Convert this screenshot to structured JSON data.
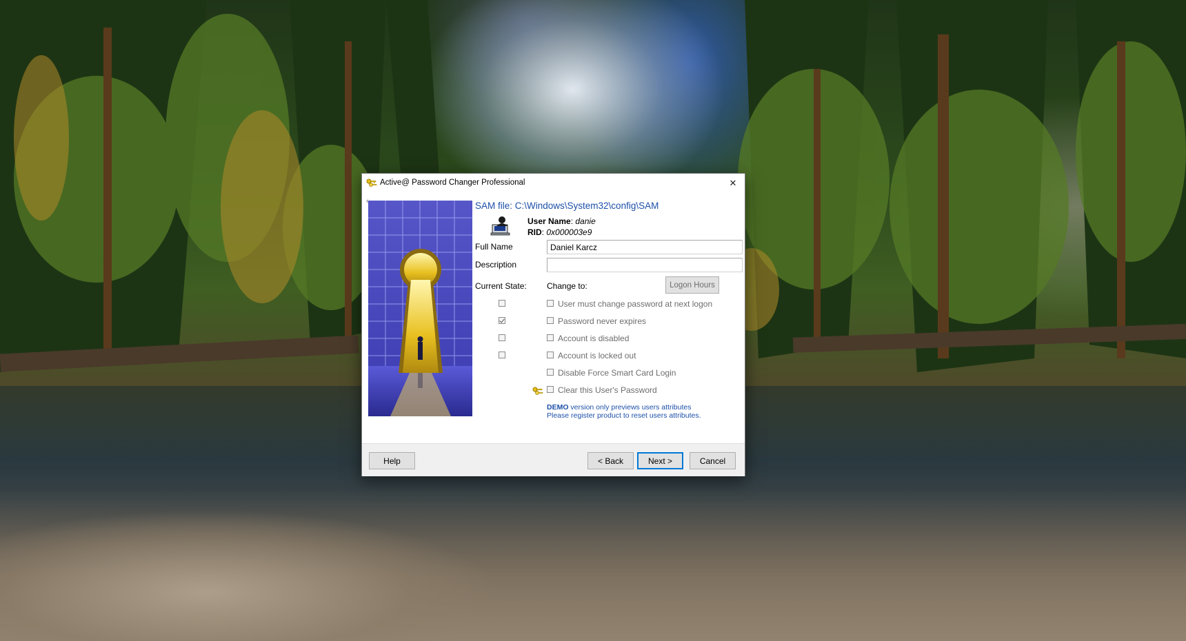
{
  "window": {
    "title": "Active@ Password Changer Professional",
    "close_glyph": "✕",
    "back_glyph": "‹"
  },
  "header": {
    "sam_path": "SAM file: C:\\Windows\\System32\\config\\SAM",
    "user_name_label": "User Name",
    "user_name_sep": ": ",
    "user_name_value": "danie",
    "rid_label": "RID",
    "rid_sep": ": ",
    "rid_value": "0x000003e9"
  },
  "fields": {
    "full_name_label": "Full Name",
    "full_name_value": "Daniel Karcz",
    "description_label": "Description",
    "description_value": ""
  },
  "state": {
    "current_state_label": "Current State:",
    "change_to_label": "Change to:",
    "logon_hours_label": "Logon Hours",
    "current": [
      false,
      true,
      false,
      false
    ],
    "options": [
      {
        "label": "User must change password at next logon",
        "checked": false
      },
      {
        "label": "Password never expires",
        "checked": false
      },
      {
        "label": "Account is disabled",
        "checked": false
      },
      {
        "label": "Account is locked out",
        "checked": false
      },
      {
        "label": "Disable Force Smart Card Login",
        "checked": false
      },
      {
        "label": "Clear this User's Password",
        "checked": false
      }
    ]
  },
  "demo": {
    "bold": "DEMO",
    "line1_rest": " version only previews users attributes",
    "line2": "Please register product to reset users attributes."
  },
  "footer": {
    "help_label": "Help",
    "back_label": "< Back",
    "next_label": "Next >",
    "cancel_label": "Cancel"
  },
  "colors": {
    "accent": "#0078d7",
    "link_blue": "#1c4fa8",
    "disabled_text": "#6d6d6d"
  },
  "icons": {
    "app": "keys-icon",
    "user": "user-computer-icon",
    "clear_password": "keys-icon"
  }
}
